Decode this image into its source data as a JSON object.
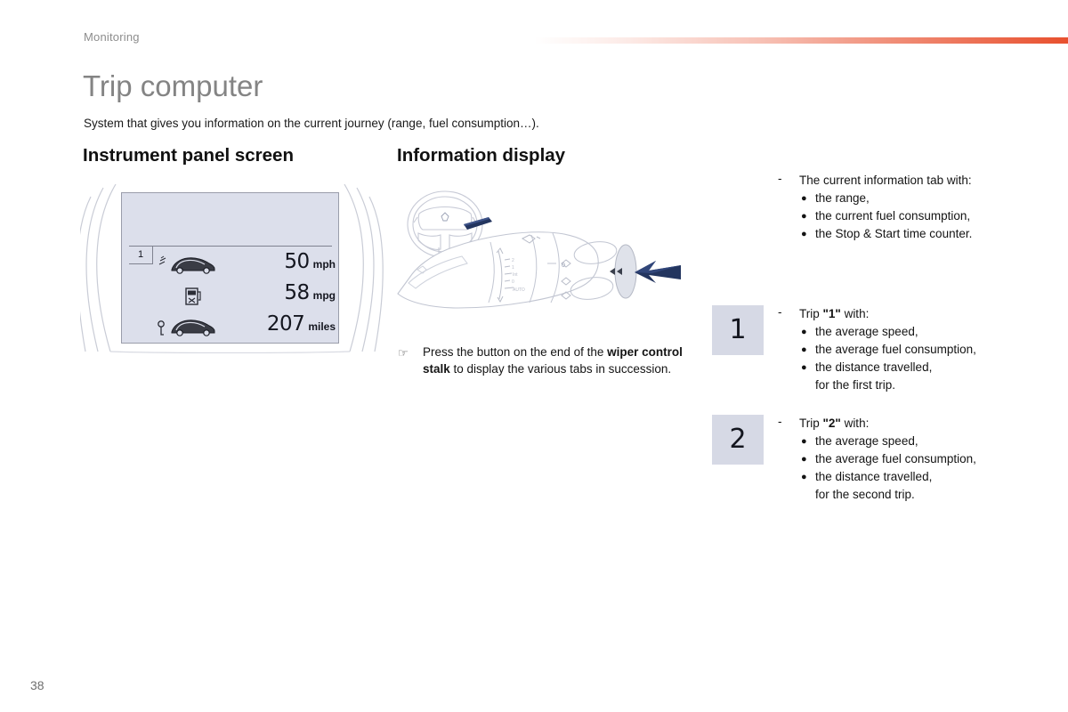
{
  "header": {
    "section_label": "Monitoring",
    "accent_color": "#e8502e"
  },
  "title": "Trip computer",
  "intro": "System that gives you information on the current journey (range, fuel consumption…).",
  "columns": {
    "left_heading": "Instrument panel screen",
    "right_heading": "Information display"
  },
  "instrument_panel": {
    "tab_number": "1",
    "screen_bg": "#dcdfeb",
    "rows": [
      {
        "icon": "car-average-speed-icon",
        "value": "50",
        "unit": "mph"
      },
      {
        "icon": "fuel-pump-icon",
        "value": "58",
        "unit": "mpg"
      },
      {
        "icon": "car-range-key-icon",
        "value": "207",
        "unit": "miles"
      }
    ]
  },
  "information_display": {
    "caption_marker": "☞",
    "caption_part1": "Press the button on the end of the ",
    "caption_bold": "wiper control stalk",
    "caption_part2": " to display the various tabs in succession.",
    "arrow_color": "#23355f"
  },
  "blocks": [
    {
      "badge": "",
      "dash": "-",
      "title_plain_before": "",
      "title_bold": "",
      "title_plain_after": "The current information tab with:",
      "items": [
        {
          "text": "the range,",
          "bullet": true
        },
        {
          "text": "the current fuel consumption,",
          "bullet": true
        },
        {
          "text": "the Stop & Start time counter.",
          "bullet": true
        }
      ]
    },
    {
      "badge": "1",
      "dash": "-",
      "title_plain_before": "Trip ",
      "title_bold": "\"1\"",
      "title_plain_after": " with:",
      "items": [
        {
          "text": "the average speed,",
          "bullet": true
        },
        {
          "text": "the average fuel consumption,",
          "bullet": true
        },
        {
          "text": "the distance travelled,",
          "bullet": true
        },
        {
          "text": "for the first trip.",
          "bullet": false
        }
      ]
    },
    {
      "badge": "2",
      "dash": "-",
      "title_plain_before": "Trip ",
      "title_bold": "\"2\"",
      "title_plain_after": " with:",
      "items": [
        {
          "text": "the average speed,",
          "bullet": true
        },
        {
          "text": "the average fuel consumption,",
          "bullet": true
        },
        {
          "text": "the distance travelled,",
          "bullet": true
        },
        {
          "text": "for the second trip.",
          "bullet": false
        }
      ]
    }
  ],
  "page_number": "38"
}
